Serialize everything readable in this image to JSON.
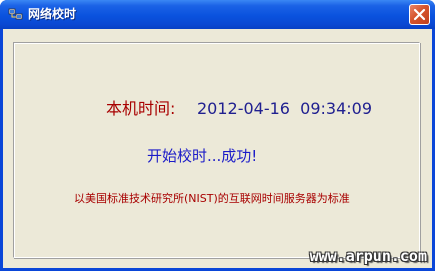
{
  "window": {
    "title": "网络校时",
    "title_icon": "app-network-icon",
    "close_icon": "close-icon"
  },
  "content": {
    "time_label": "本机时间:",
    "time_value": "2012-04-16  09:34:09",
    "status": "开始校时...成功!",
    "note": "以美国标准技术研究所(NIST)的互联网时间服务器为标准"
  },
  "watermark": "www.arpun.com",
  "colors": {
    "titlebar": "#0a52de",
    "client_bg": "#ece9d8",
    "label_red": "#a80000",
    "value_blue": "#202090",
    "status_blue": "#1c1cc8"
  }
}
